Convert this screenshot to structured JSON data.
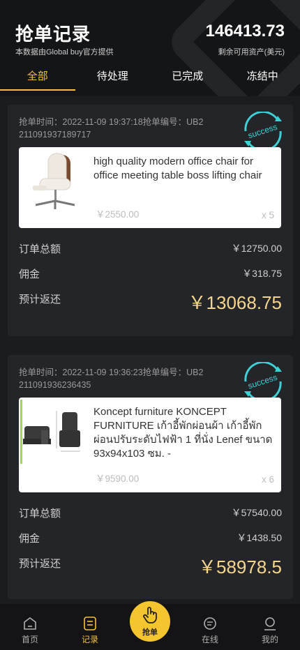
{
  "header": {
    "title": "抢单记录",
    "subtitle": "本数据由Global buy官方提供",
    "balance": "146413.73",
    "balance_label": "剩余可用资产(美元)"
  },
  "tabs": [
    {
      "label": "全部",
      "active": true
    },
    {
      "label": "待处理",
      "active": false
    },
    {
      "label": "已完成",
      "active": false
    },
    {
      "label": "冻结中",
      "active": false
    }
  ],
  "orders": [
    {
      "meta": "抢单时间：2022-11-09 19:37:18抢单编号：UB2211091937189717",
      "stamp": "success",
      "product_name": "high quality modern office chair for office meeting table boss lifting chair",
      "price": "￥2550.00",
      "qty": "x 5",
      "total_label": "订单总额",
      "total": "￥12750.00",
      "commission_label": "佣金",
      "commission": "￥318.75",
      "return_label": "预计返还",
      "return": "￥13068.75"
    },
    {
      "meta": "抢单时间：2022-11-09 19:36:23抢单编号：UB2211091936236435",
      "stamp": "success",
      "product_name": "Koncept furniture KONCEPT FURNITURE เก้าอี้พักผ่อนผ้า เก้าอี้พักผ่อนปรับระดับไฟฟ้า 1 ที่นั่ง Lenef ขนาด 93x94x103 ซม. -",
      "price": "￥9590.00",
      "qty": "x 6",
      "total_label": "订单总额",
      "total": "￥57540.00",
      "commission_label": "佣金",
      "commission": "￥1438.50",
      "return_label": "预计返还",
      "return": "￥58978.5"
    }
  ],
  "nav": {
    "home": "首页",
    "records": "记录",
    "grab": "抢单",
    "online": "在线",
    "mine": "我的"
  },
  "colors": {
    "accent": "#f3c23a",
    "amount": "#f6d58d",
    "stamp": "#3fd0d6",
    "background": "#1b1c1e"
  }
}
